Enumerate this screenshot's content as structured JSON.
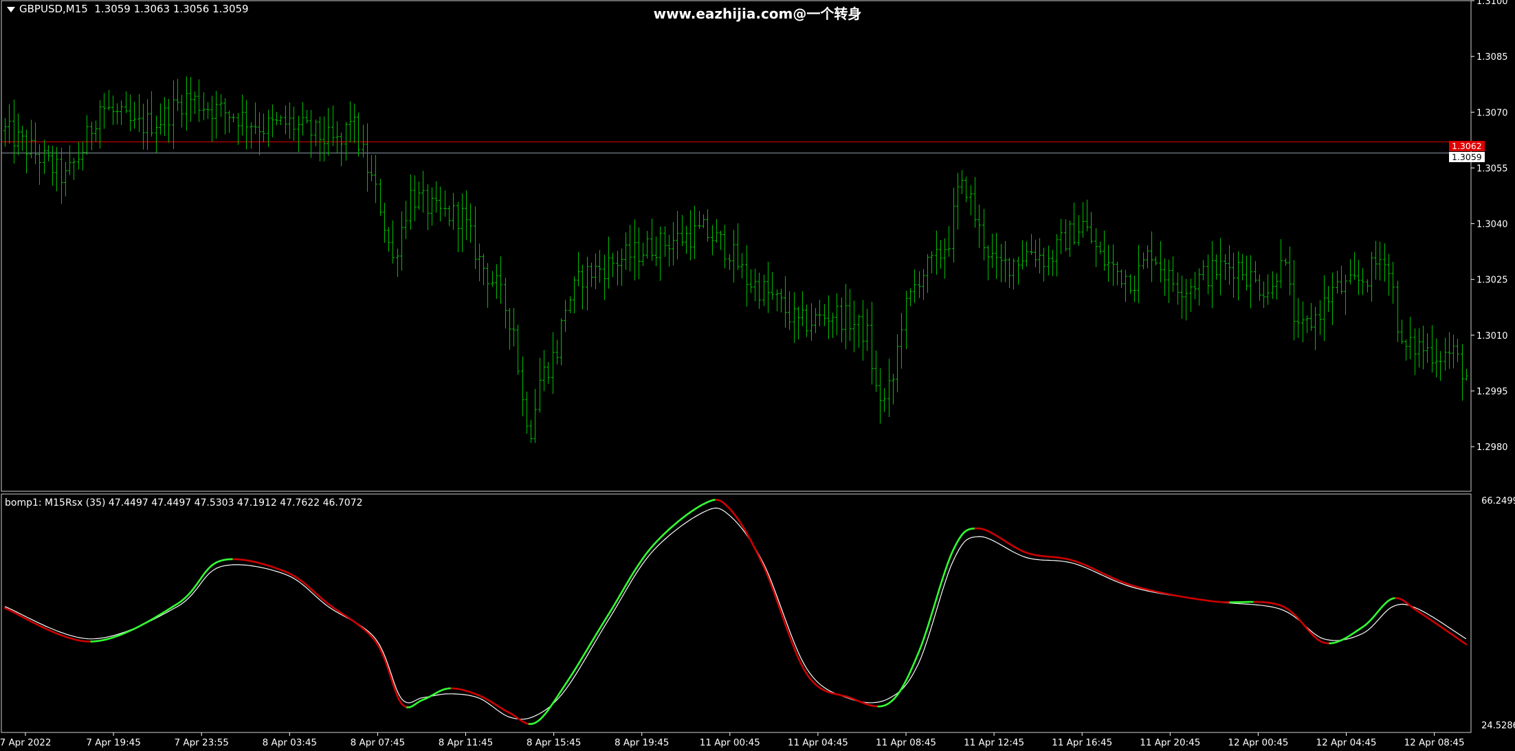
{
  "chart_title": {
    "symbol_label": "GBPUSD,M15",
    "ohlc_label": "1.3059 1.3063 1.3056 1.3059"
  },
  "watermark": "www.eazhijia.com@一个转身",
  "indicator_label": "bomp1: M15Rsx (35) 47.4497 47.4497 47.5303 47.1912 47.7622 46.7072",
  "colors": {
    "background": "#000000",
    "bar": "#00c000",
    "ask_line": "#e00000",
    "bid_line": "#8fa0b0",
    "rsx_up": "#33ff33",
    "rsx_down": "#cc0000",
    "signal": "#ffffff"
  },
  "chart_data": [
    {
      "type": "ohlc",
      "symbol": "GBPUSD",
      "timeframe": "M15",
      "price_axis": {
        "range": [
          1.2968,
          1.31
        ],
        "tick_labels": [
          "1.3100",
          "1.3085",
          "1.3070",
          "1.3055",
          "1.3040",
          "1.3025",
          "1.3010",
          "1.2995",
          "1.2980"
        ]
      },
      "horizontal_lines": [
        {
          "value": 1.3062,
          "label": "1.3062",
          "color": "#e00000"
        },
        {
          "value": 1.3059,
          "label": "1.3059",
          "color": "#8fa0b0"
        }
      ],
      "time_labels": [
        "7 Apr 2022",
        "7 Apr 19:45",
        "7 Apr 23:55",
        "8 Apr 03:45",
        "8 Apr 07:45",
        "8 Apr 11:45",
        "8 Apr 15:45",
        "8 Apr 19:45",
        "11 Apr 00:45",
        "11 Apr 04:45",
        "11 Apr 08:45",
        "11 Apr 12:45",
        "11 Apr 16:45",
        "11 Apr 20:45",
        "12 Apr 00:45",
        "12 Apr 04:45",
        "12 Apr 08:45"
      ],
      "close_path": [
        [
          0,
          1.3065
        ],
        [
          8,
          1.3058
        ],
        [
          14,
          1.3052
        ],
        [
          18,
          1.306
        ],
        [
          22,
          1.3072
        ],
        [
          30,
          1.3066
        ],
        [
          36,
          1.3068
        ],
        [
          42,
          1.3074
        ],
        [
          48,
          1.3071
        ],
        [
          54,
          1.3069
        ],
        [
          60,
          1.3066
        ],
        [
          66,
          1.3067
        ],
        [
          72,
          1.3064
        ],
        [
          78,
          1.3061
        ],
        [
          80,
          1.3069
        ],
        [
          84,
          1.3055
        ],
        [
          87,
          1.3045
        ],
        [
          90,
          1.303
        ],
        [
          94,
          1.3048
        ],
        [
          100,
          1.3043
        ],
        [
          106,
          1.3042
        ],
        [
          110,
          1.303
        ],
        [
          114,
          1.3023
        ],
        [
          118,
          1.3012
        ],
        [
          120,
          1.2992
        ],
        [
          122,
          1.2985
        ],
        [
          124,
          1.2998
        ],
        [
          128,
          1.3006
        ],
        [
          130,
          1.3018
        ],
        [
          134,
          1.3026
        ],
        [
          138,
          1.3028
        ],
        [
          144,
          1.3031
        ],
        [
          150,
          1.3034
        ],
        [
          156,
          1.3036
        ],
        [
          162,
          1.3038
        ],
        [
          168,
          1.3033
        ],
        [
          172,
          1.3025
        ],
        [
          176,
          1.3022
        ],
        [
          180,
          1.3018
        ],
        [
          184,
          1.3013
        ],
        [
          188,
          1.3014
        ],
        [
          192,
          1.3016
        ],
        [
          196,
          1.3014
        ],
        [
          200,
          1.301
        ],
        [
          202,
          1.2995
        ],
        [
          204,
          1.2992
        ],
        [
          206,
          1.2998
        ],
        [
          208,
          1.3014
        ],
        [
          212,
          1.3026
        ],
        [
          216,
          1.303
        ],
        [
          219,
          1.3036
        ],
        [
          221,
          1.3048
        ],
        [
          223,
          1.305
        ],
        [
          226,
          1.3038
        ],
        [
          230,
          1.3028
        ],
        [
          234,
          1.303
        ],
        [
          238,
          1.3033
        ],
        [
          242,
          1.303
        ],
        [
          246,
          1.3036
        ],
        [
          250,
          1.304
        ],
        [
          254,
          1.3031
        ],
        [
          258,
          1.3027
        ],
        [
          262,
          1.3025
        ],
        [
          266,
          1.3033
        ],
        [
          270,
          1.3025
        ],
        [
          274,
          1.3023
        ],
        [
          278,
          1.3026
        ],
        [
          282,
          1.3028
        ],
        [
          286,
          1.3029
        ],
        [
          290,
          1.3024
        ],
        [
          294,
          1.3022
        ],
        [
          296,
          1.3033
        ],
        [
          298,
          1.3021
        ],
        [
          300,
          1.301
        ],
        [
          304,
          1.3015
        ],
        [
          308,
          1.3022
        ],
        [
          312,
          1.3023
        ],
        [
          316,
          1.3026
        ],
        [
          320,
          1.3032
        ],
        [
          322,
          1.3022
        ],
        [
          324,
          1.3006
        ],
        [
          328,
          1.3007
        ],
        [
          332,
          1.3005
        ],
        [
          336,
          1.3005
        ],
        [
          339,
          1.2999
        ]
      ]
    },
    {
      "type": "line",
      "name": "M15Rsx (35)",
      "value_axis": {
        "range": [
          24.5286,
          66.2499
        ],
        "tick_labels": [
          "66.2499",
          "24.5286"
        ]
      },
      "series": [
        {
          "name": "Rsx",
          "points": [
            [
              0,
              46.2
            ],
            [
              20,
              40.0
            ],
            [
              40,
              47.0
            ],
            [
              50,
              55.0
            ],
            [
              65,
              53.0
            ],
            [
              75,
              47.0
            ],
            [
              86,
              40.0
            ],
            [
              92,
              28.5
            ],
            [
              97,
              29.2
            ],
            [
              103,
              31.3
            ],
            [
              110,
              30.0
            ],
            [
              117,
              26.8
            ],
            [
              123,
              24.9
            ],
            [
              130,
              32.0
            ],
            [
              140,
              45.0
            ],
            [
              150,
              57.5
            ],
            [
              162,
              65.5
            ],
            [
              168,
              64.8
            ],
            [
              176,
              54.0
            ],
            [
              186,
              34.0
            ],
            [
              196,
              29.6
            ],
            [
              205,
              28.5
            ],
            [
              212,
              38.0
            ],
            [
              220,
              57.0
            ],
            [
              226,
              61.0
            ],
            [
              237,
              56.5
            ],
            [
              248,
              55.0
            ],
            [
              262,
              50.3
            ],
            [
              280,
              47.5
            ],
            [
              296,
              46.7
            ],
            [
              306,
              39.8
            ],
            [
              315,
              42.7
            ],
            [
              322,
              48.0
            ],
            [
              328,
              45.5
            ],
            [
              339,
              39.5
            ]
          ]
        },
        {
          "name": "Signal",
          "points": [
            [
              0,
              46.5
            ],
            [
              20,
              40.5
            ],
            [
              40,
              46.5
            ],
            [
              50,
              53.9
            ],
            [
              65,
              52.5
            ],
            [
              75,
              46.5
            ],
            [
              86,
              40.5
            ],
            [
              92,
              29.4
            ],
            [
              97,
              29.6
            ],
            [
              103,
              30.3
            ],
            [
              110,
              29.5
            ],
            [
              117,
              26.0
            ],
            [
              123,
              26.2
            ],
            [
              130,
              31.0
            ],
            [
              140,
              44.0
            ],
            [
              150,
              56.5
            ],
            [
              162,
              64.0
            ],
            [
              168,
              63.5
            ],
            [
              176,
              54.5
            ],
            [
              186,
              35.0
            ],
            [
              196,
              29.4
            ],
            [
              205,
              29.4
            ],
            [
              212,
              36.0
            ],
            [
              220,
              55.0
            ],
            [
              226,
              59.5
            ],
            [
              237,
              55.6
            ],
            [
              248,
              54.5
            ],
            [
              262,
              50.0
            ],
            [
              280,
              47.5
            ],
            [
              296,
              46.0
            ],
            [
              306,
              40.5
            ],
            [
              315,
              41.5
            ],
            [
              322,
              46.5
            ],
            [
              328,
              46.0
            ],
            [
              339,
              40.5
            ]
          ]
        }
      ]
    }
  ]
}
